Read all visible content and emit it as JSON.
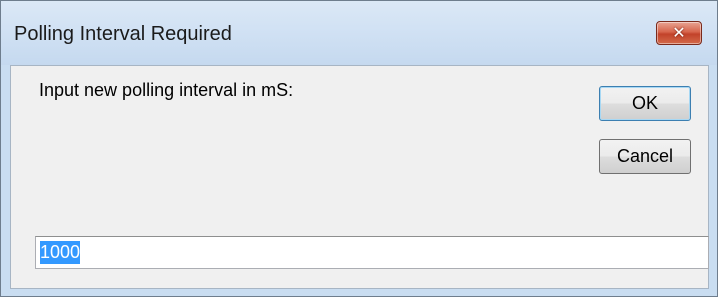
{
  "dialog": {
    "title": "Polling Interval Required",
    "close_icon": "close-icon",
    "prompt": "Input new polling interval in mS:",
    "ok_label": "OK",
    "cancel_label": "Cancel",
    "input_value": "1000"
  }
}
